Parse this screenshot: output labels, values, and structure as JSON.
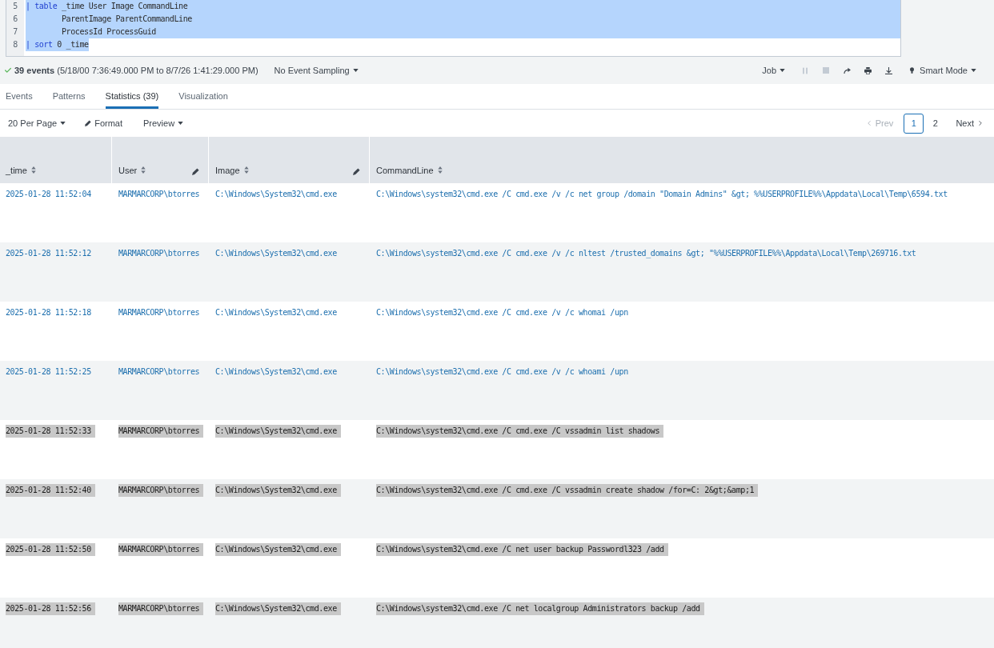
{
  "editor": {
    "lines": [
      {
        "number": "5",
        "selected": true,
        "tokens": [
          {
            "kind": "keyword",
            "text": "| table"
          },
          {
            "kind": "plain",
            "text": " _time User Image CommandLine"
          }
        ]
      },
      {
        "number": "6",
        "selected": true,
        "tokens": [
          {
            "kind": "plain",
            "text": "        ParentImage ParentCommandLine"
          }
        ]
      },
      {
        "number": "7",
        "selected": true,
        "tokens": [
          {
            "kind": "plain",
            "text": "        ProcessId ProcessGuid"
          }
        ]
      },
      {
        "number": "8",
        "selected": true,
        "tokens": [
          {
            "kind": "keyword",
            "text": "| sort"
          },
          {
            "kind": "plain",
            "text": " 0 _time"
          }
        ]
      }
    ]
  },
  "status": {
    "summary": "**39 events** (5/18/00 7:36:49.000 PM to 8/7/26 1:41:29.000 PM)",
    "sampling": "No Event Sampling",
    "job": "Job",
    "job_controls": [
      {
        "kind": "pause",
        "disabled": true
      },
      {
        "kind": "stop",
        "disabled": true
      },
      {
        "kind": "share",
        "disabled": false
      },
      {
        "kind": "print",
        "disabled": false
      },
      {
        "kind": "export",
        "disabled": false
      }
    ],
    "mode": "Smart Mode"
  },
  "tabs": [
    {
      "label": "Events",
      "selected": false
    },
    {
      "label": "Patterns",
      "selected": false
    },
    {
      "label": "Statistics (39)",
      "selected": true
    },
    {
      "label": "Visualization",
      "selected": false
    }
  ],
  "table_options": {
    "per_page": "20 Per Page",
    "format": "Format",
    "preview": "Preview"
  },
  "pagination": {
    "prev": {
      "label": "Prev",
      "disabled": true
    },
    "pages": [
      {
        "label": "1",
        "selected": true
      },
      {
        "label": "2",
        "selected": false
      }
    ],
    "next": {
      "label": "Next",
      "disabled": false
    }
  },
  "table": {
    "columns": [
      {
        "label": "_time",
        "editable": false
      },
      {
        "label": "User",
        "editable": true
      },
      {
        "label": "Image",
        "editable": true
      },
      {
        "label": "CommandLine",
        "editable": false
      }
    ],
    "rows": [
      {
        "highlighted": false,
        "cells": [
          "2025-01-28 11:52:04",
          "MARMARCORP\\btorres",
          "C:\\Windows\\System32\\cmd.exe",
          "C:\\Windows\\system32\\cmd.exe /C cmd.exe /v /c net group /domain \"Domain Admins\" &gt; %%USERPROFILE%%\\Appdata\\Local\\Temp\\6594.txt"
        ]
      },
      {
        "highlighted": false,
        "cells": [
          "2025-01-28 11:52:12",
          "MARMARCORP\\btorres",
          "C:\\Windows\\System32\\cmd.exe",
          "C:\\Windows\\system32\\cmd.exe /C cmd.exe /v /c nltest /trusted_domains &gt; \"%%USERPROFILE%%\\Appdata\\Local\\Temp\\269716.txt"
        ]
      },
      {
        "highlighted": false,
        "cells": [
          "2025-01-28 11:52:18",
          "MARMARCORP\\btorres",
          "C:\\Windows\\System32\\cmd.exe",
          "C:\\Windows\\system32\\cmd.exe /C cmd.exe /v /c whomai /upn"
        ]
      },
      {
        "highlighted": false,
        "cells": [
          "2025-01-28 11:52:25",
          "MARMARCORP\\btorres",
          "C:\\Windows\\System32\\cmd.exe",
          "C:\\Windows\\system32\\cmd.exe /C cmd.exe /v /c whoami /upn"
        ]
      },
      {
        "highlighted": true,
        "cells": [
          "2025-01-28 11:52:33",
          "MARMARCORP\\btorres",
          "C:\\Windows\\System32\\cmd.exe",
          "C:\\Windows\\system32\\cmd.exe /C cmd.exe /C vssadmin list shadows"
        ]
      },
      {
        "highlighted": true,
        "cells": [
          "2025-01-28 11:52:40",
          "MARMARCORP\\btorres",
          "C:\\Windows\\System32\\cmd.exe",
          "C:\\Windows\\system32\\cmd.exe /C cmd.exe /C vssadmin create shadow /for=C: 2&gt;&amp;1"
        ]
      },
      {
        "highlighted": true,
        "cells": [
          "2025-01-28 11:52:50",
          "MARMARCORP\\btorres",
          "C:\\Windows\\System32\\cmd.exe",
          "C:\\Windows\\system32\\cmd.exe /C net user backup Passwordl323 /add"
        ]
      },
      {
        "highlighted": true,
        "cells": [
          "2025-01-28 11:52:56",
          "MARMARCORP\\btorres",
          "C:\\Windows\\System32\\cmd.exe",
          "C:\\Windows\\system32\\cmd.exe /C net localgroup Administrators backup /add"
        ]
      }
    ]
  }
}
